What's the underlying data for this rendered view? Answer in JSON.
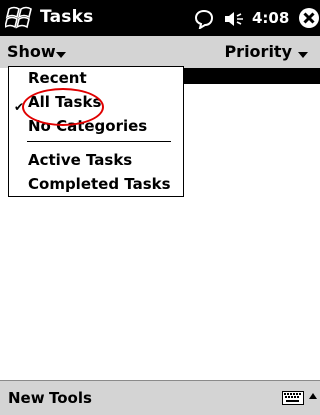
{
  "title_bar": {
    "app_title": "Tasks",
    "time": "4:08",
    "icons": [
      "windows-start-icon",
      "message-bubble-icon",
      "speaker-icon",
      "close-icon"
    ]
  },
  "filter_bar": {
    "show_label": "Show",
    "priority_label": "Priority"
  },
  "show_menu": {
    "items": [
      {
        "label": "Recent",
        "checked": false
      },
      {
        "label": "All Tasks",
        "checked": true
      },
      {
        "label": "No Categories",
        "checked": false
      },
      {
        "label": "Active Tasks",
        "checked": false
      },
      {
        "label": "Completed Tasks",
        "checked": false
      }
    ]
  },
  "bottom_bar": {
    "new_label": "New",
    "tools_label": "Tools",
    "icons": [
      "keyboard-icon",
      "input-panel-arrow-icon"
    ]
  },
  "colors": {
    "title_bar_bg": "#000000",
    "bar_bg": "#d4d4d4",
    "highlight_ring": "#e00000"
  }
}
